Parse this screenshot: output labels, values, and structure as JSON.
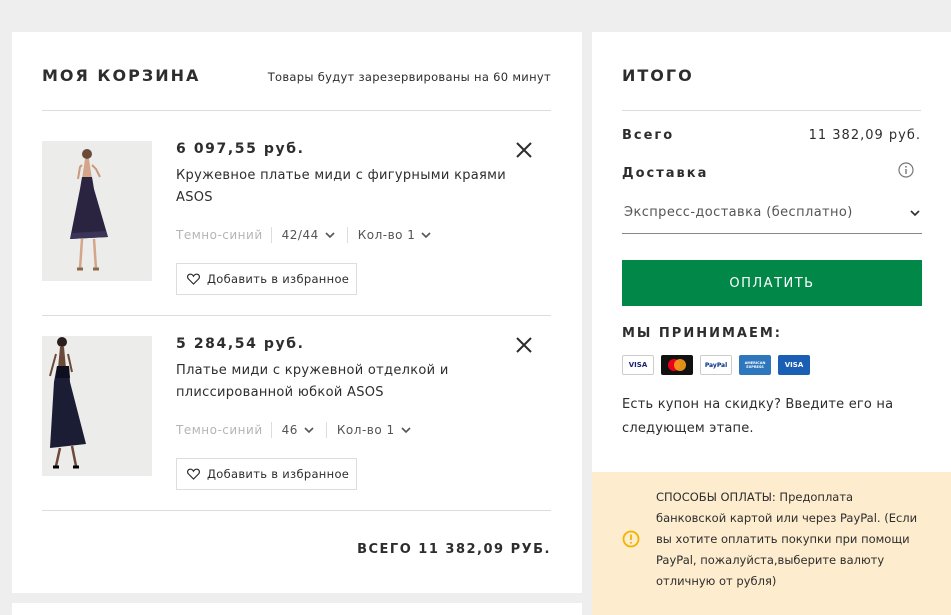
{
  "cart": {
    "title": "МОЯ КОРЗИНА",
    "reserve_note": "Товары будут зарезервированы на 60 минут",
    "items": [
      {
        "price": "6 097,55 руб.",
        "name": "Кружевное платье миди с фигурными краями ASOS",
        "color": "Темно-синий",
        "size": "42/44",
        "qty": "Кол-во 1",
        "favorite": "Добавить в избранное"
      },
      {
        "price": "5 284,54 руб.",
        "name": "Платье миди с кружевной отделкой и плиссированной юбкой ASOS",
        "color": "Темно-синий",
        "size": "46",
        "qty": "Кол-во 1",
        "favorite": "Добавить в избранное"
      }
    ],
    "total": "ВСЕГО 11 382,09 РУБ."
  },
  "summary": {
    "title": "ИТОГО",
    "subtotal_label": "Всего",
    "subtotal_value": "11 382,09 руб.",
    "delivery_label": "Доставка",
    "delivery_option": "Экспресс-доставка (бесплатно)",
    "pay_button": "ОПЛАТИТЬ",
    "accept_title": "МЫ ПРИНИМАЕМ:",
    "cards": [
      {
        "label": "VISA",
        "icon": "visa-card-icon"
      },
      {
        "label": "",
        "icon": "mastercard-icon"
      },
      {
        "label": "PayPal",
        "icon": "paypal-icon"
      },
      {
        "label": "AMERICAN EXPRESS",
        "icon": "amex-icon"
      },
      {
        "label": "VISA",
        "icon": "visa-electron-icon"
      }
    ],
    "coupon_text": "Есть купон на скидку? Введите его на следующем этапе."
  },
  "notice": {
    "text": "СПОСОБЫ ОПЛАТЫ: Предоплата банковской картой или через PayPal. (Если вы хотите оплатить покупки при помощи PayPal, пожалуйста,выберите валюту отличную от рубля)"
  },
  "colors": {
    "accent_green": "#018849",
    "notice_bg": "#fdeccd",
    "notice_icon": "#f0b400"
  }
}
